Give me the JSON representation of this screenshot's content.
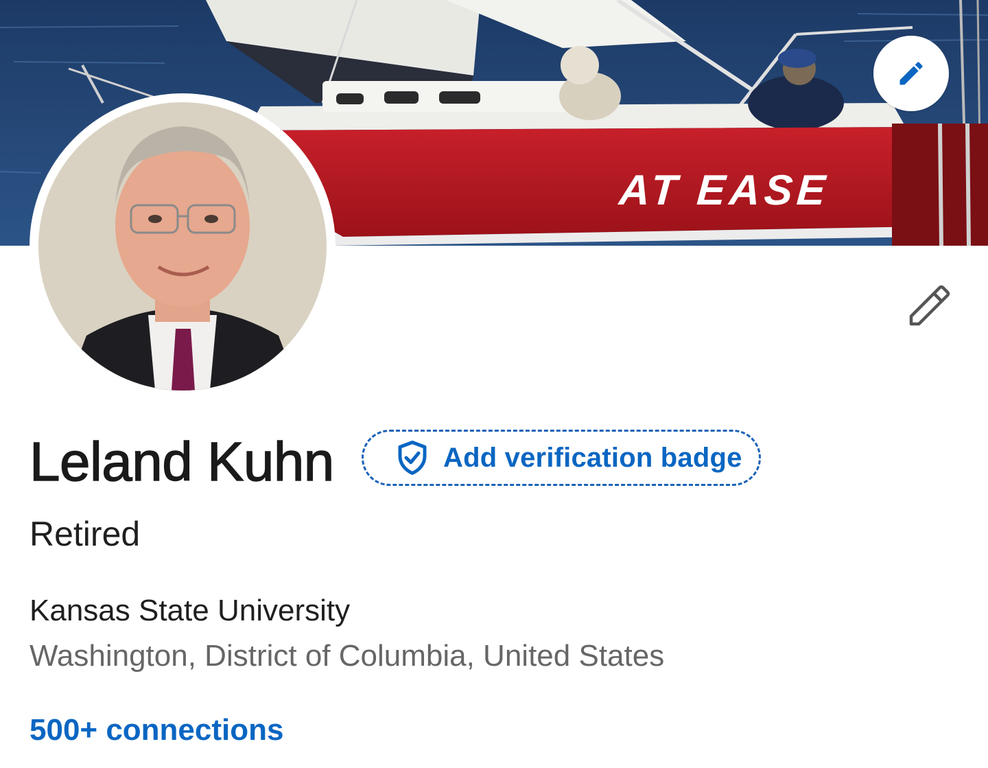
{
  "cover": {
    "boat_name": "AT EASE"
  },
  "profile": {
    "name": "Leland Kuhn",
    "verification_label": "Add verification badge",
    "headline": "Retired",
    "education": "Kansas State University",
    "location": "Washington, District of Columbia, United States",
    "connections": "500+ connections"
  },
  "colors": {
    "accent": "#0a66c2",
    "text_primary": "#1a1a1a",
    "text_secondary": "#666666"
  },
  "icons": {
    "cover_edit": "pencil-icon",
    "intro_edit": "pencil-icon",
    "verification": "shield-check-icon"
  }
}
